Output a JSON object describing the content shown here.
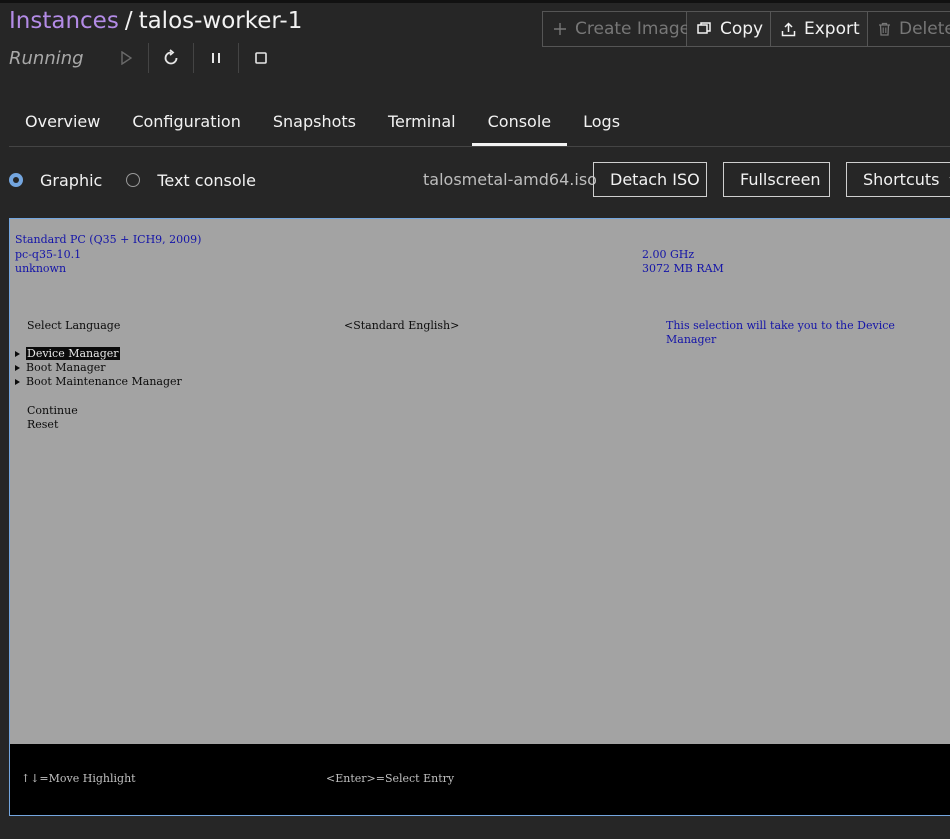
{
  "breadcrumb": {
    "parent": "Instances",
    "separator": "/",
    "current": "talos-worker-1"
  },
  "status": {
    "text": "Running"
  },
  "controls": {
    "start_icon": "play-icon",
    "restart_icon": "restart-icon",
    "pause_icon": "pause-icon",
    "stop_icon": "stop-icon"
  },
  "actions": {
    "create_image": "Create Image",
    "copy": "Copy",
    "export": "Export",
    "delete": "Delete"
  },
  "tabs": [
    {
      "label": "Overview"
    },
    {
      "label": "Configuration"
    },
    {
      "label": "Snapshots"
    },
    {
      "label": "Terminal"
    },
    {
      "label": "Console",
      "active": true
    },
    {
      "label": "Logs"
    }
  ],
  "console": {
    "mode_graphic": "Graphic",
    "mode_text": "Text console",
    "selected_mode": "Graphic",
    "iso": "talosmetal-amd64.iso",
    "detach_iso": "Detach ISO",
    "fullscreen": "Fullscreen",
    "shortcuts": "Shortcuts"
  },
  "vm": {
    "machine": "Standard PC (Q35 + ICH9, 2009)",
    "model": "pc-q35-10.1",
    "serial": "unknown",
    "cpu": "2.00 GHz",
    "ram": "3072 MB RAM",
    "select_language_label": "Select Language",
    "select_language_value": "<Standard English>",
    "help_line1": "This selection will take you to the Device",
    "help_line2": "Manager",
    "menu": [
      "Device Manager",
      "Boot Manager",
      "Boot Maintenance Manager"
    ],
    "continue": "Continue",
    "reset": "Reset",
    "footer_move": "↑↓=Move Highlight",
    "footer_select": "<Enter>=Select Entry"
  },
  "colors": {
    "accent": "#b38be6",
    "focus": "#74a6df",
    "vm_bg": "#a3a3a3",
    "vm_text_blue": "#1414a8"
  }
}
